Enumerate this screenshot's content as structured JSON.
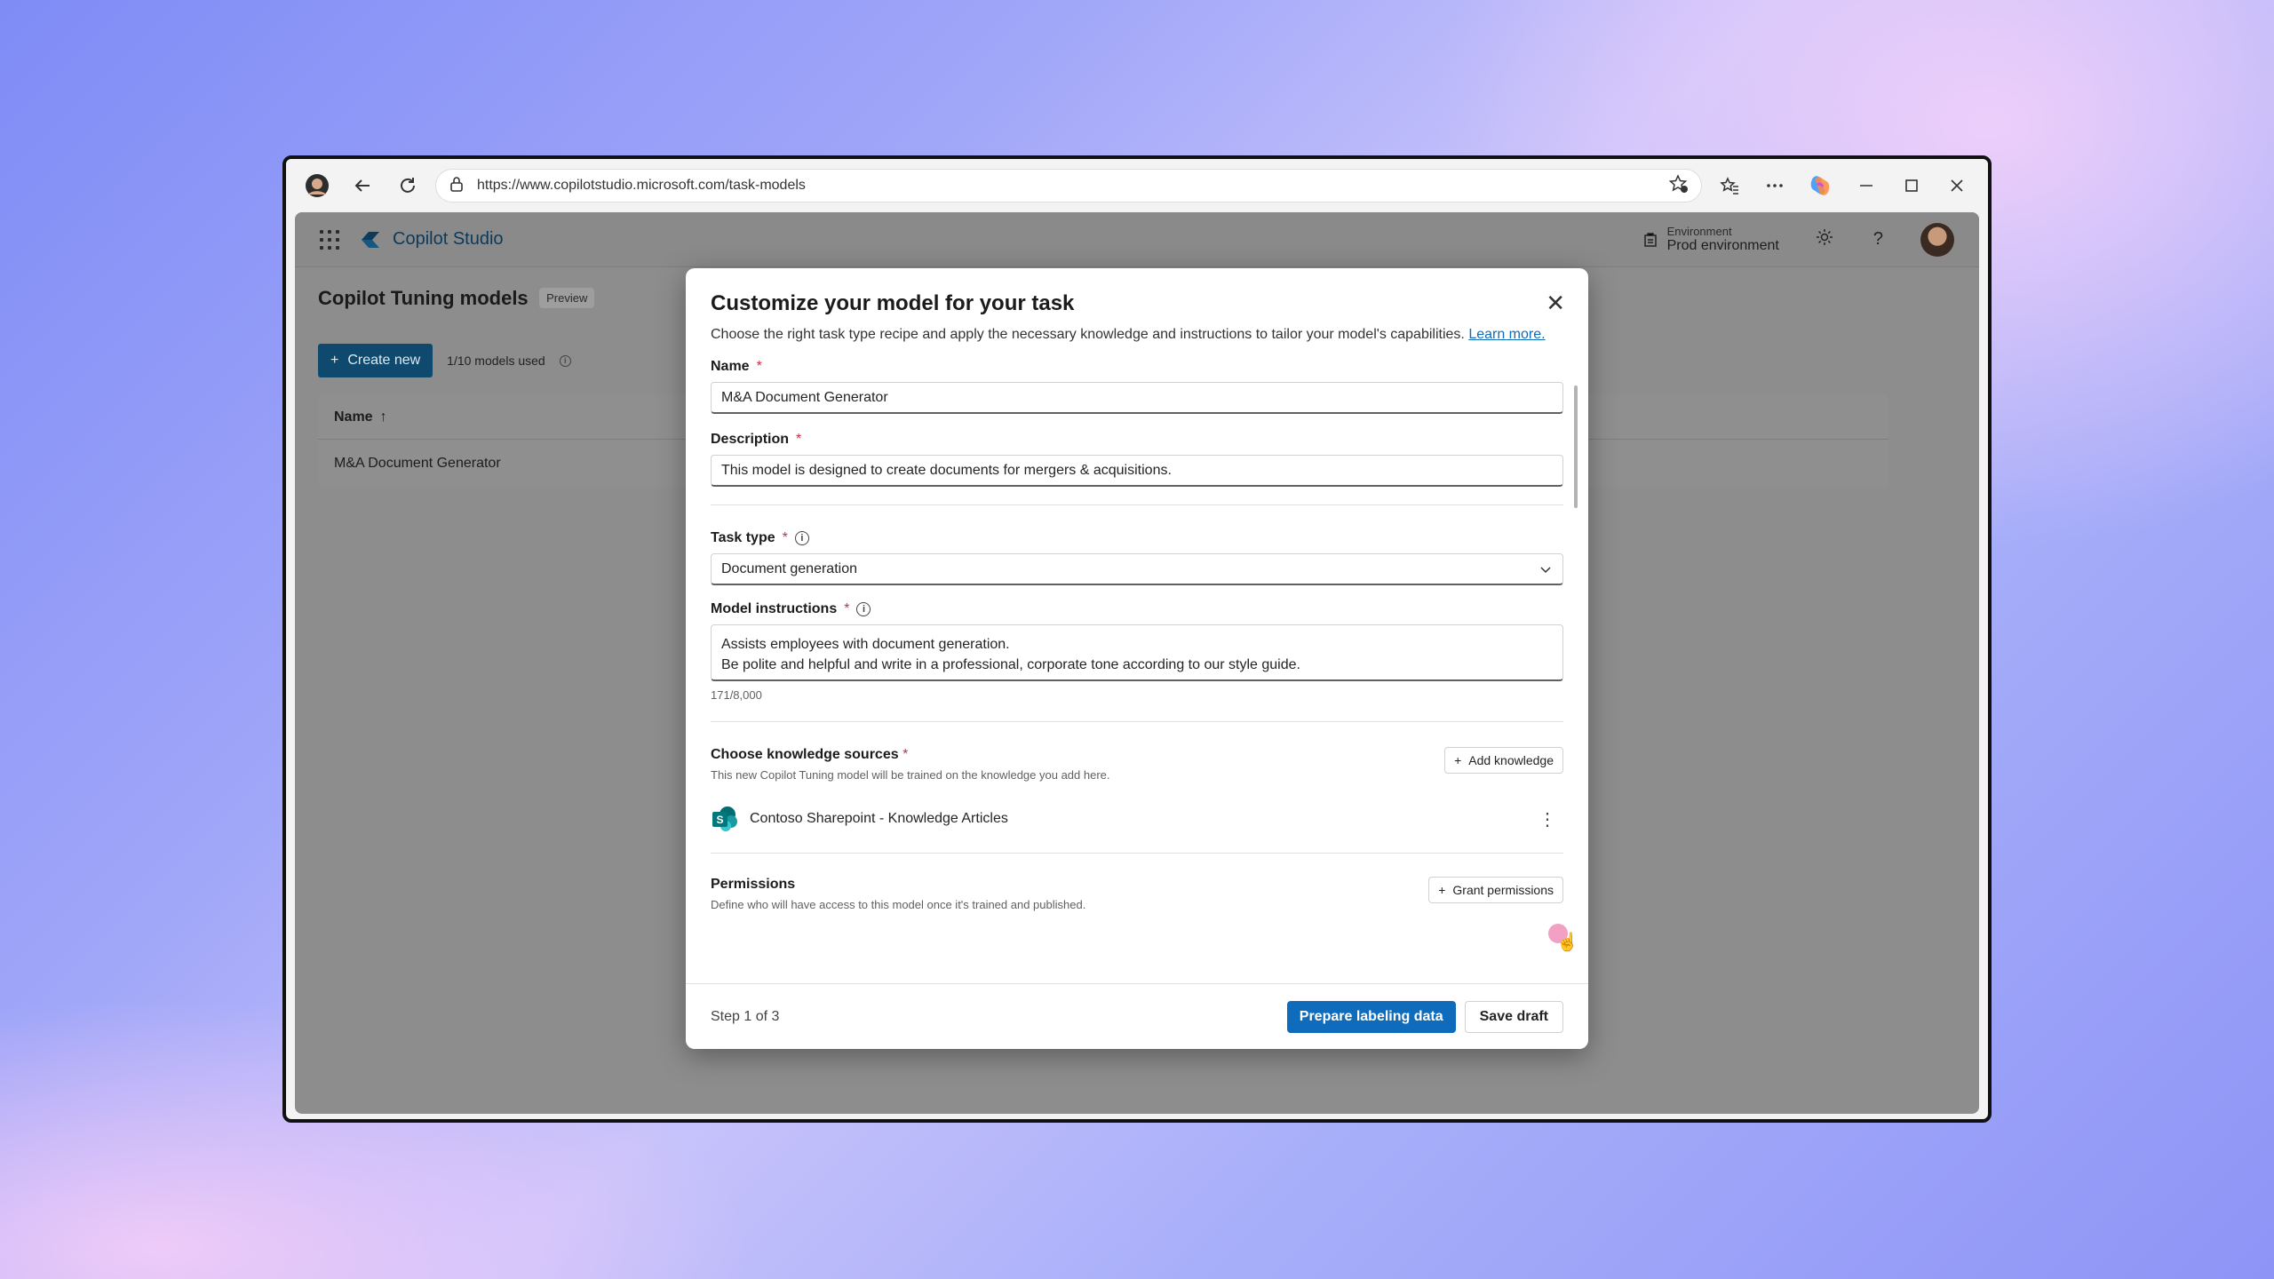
{
  "browser": {
    "url": "https://www.copilotstudio.microsoft.com/task-models"
  },
  "app": {
    "brand": "Copilot Studio",
    "environment_label": "Environment",
    "environment_value": "Prod environment"
  },
  "page": {
    "title": "Copilot Tuning models",
    "badge": "Preview",
    "create_label": "Create new",
    "models_used": "1/10 models used",
    "table": {
      "header": "Name",
      "rows": [
        "M&A Document Generator"
      ]
    }
  },
  "dialog": {
    "title": "Customize your model for your task",
    "subtitle": "Choose the right task type recipe and apply the necessary knowledge and instructions to tailor your model's capabilities.",
    "learn_more": "Learn more.",
    "name_label": "Name",
    "name_value": "M&A Document Generator",
    "description_label": "Description",
    "description_value": "This model is designed to create documents for mergers & acquisitions.",
    "task_type_label": "Task type",
    "task_type_value": "Document generation",
    "instructions_label": "Model instructions",
    "instructions_line1": "Assists employees with document generation.",
    "instructions_line2": "Be polite and helpful and write in a professional, corporate tone according to our style guide.",
    "instructions_counter": "171/8,000",
    "knowledge_title": "Choose knowledge sources",
    "knowledge_desc": "This new Copilot Tuning model will be trained on the knowledge you add here.",
    "add_knowledge": "Add knowledge",
    "knowledge_item": "Contoso Sharepoint - Knowledge Articles",
    "permissions_title": "Permissions",
    "permissions_desc": "Define who will have access to this model once it's trained and published.",
    "grant_permissions": "Grant permissions",
    "step": "Step 1 of 3",
    "primary_button": "Prepare labeling data",
    "secondary_button": "Save draft",
    "required_mark": "*"
  },
  "colors": {
    "primary": "#0f6cbd",
    "required": "#c4314b"
  }
}
